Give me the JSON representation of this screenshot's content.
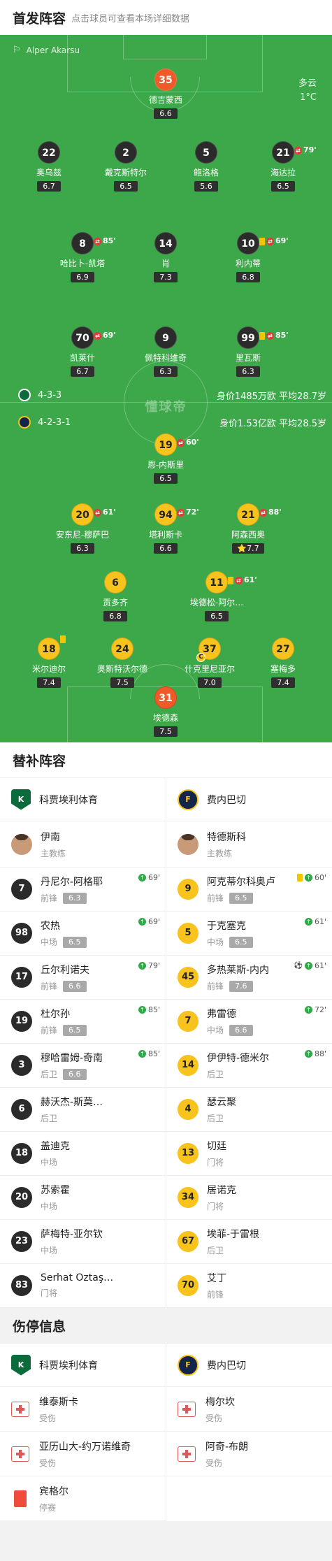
{
  "lineup": {
    "title": "首发阵容",
    "subtitle": "点击球员可查看本场详细数据",
    "referee": "Alper Akarsu",
    "weather": {
      "desc": "多云",
      "temp": "1°C"
    },
    "watermark": "懂球帝",
    "home": {
      "formation": "4-3-3",
      "worth": "身价1485万欧",
      "age": "平均28.7岁",
      "color": "#0c6b3c"
    },
    "away": {
      "formation": "4-2-3-1",
      "worth": "身价1.53亿欧",
      "age": "平均28.5岁",
      "color": "#13254b"
    },
    "players": [
      {
        "num": "35",
        "name": "德吉蒙西",
        "rating": "6.6",
        "side": "gk-home"
      },
      {
        "num": "22",
        "name": "奥乌兹",
        "rating": "6.7",
        "side": "home"
      },
      {
        "num": "2",
        "name": "戴克斯特尔",
        "rating": "6.5",
        "side": "home"
      },
      {
        "num": "5",
        "name": "鲍洛格",
        "rating": "5.6",
        "side": "home"
      },
      {
        "num": "21",
        "name": "海达拉",
        "rating": "6.5",
        "side": "home",
        "sub": "79'"
      },
      {
        "num": "8",
        "name": "哈比卜-凯塔",
        "rating": "6.9",
        "side": "home",
        "sub": "85'"
      },
      {
        "num": "14",
        "name": "肖",
        "rating": "7.3",
        "side": "home"
      },
      {
        "num": "10",
        "name": "利内蒂",
        "rating": "6.8",
        "side": "home",
        "sub": "69'",
        "card": "yellow"
      },
      {
        "num": "70",
        "name": "凯莱什",
        "rating": "6.7",
        "side": "home",
        "sub": "69'"
      },
      {
        "num": "9",
        "name": "佩特科维奇",
        "rating": "6.3",
        "side": "home"
      },
      {
        "num": "99",
        "name": "里瓦斯",
        "rating": "6.3",
        "side": "home",
        "sub": "85'",
        "card": "yellow"
      },
      {
        "num": "19",
        "name": "恩-内斯里",
        "rating": "6.5",
        "side": "away",
        "sub": "60'"
      },
      {
        "num": "20",
        "name": "安东尼-穆萨巴",
        "rating": "6.3",
        "side": "away",
        "sub": "61'"
      },
      {
        "num": "94",
        "name": "塔利斯卡",
        "rating": "6.6",
        "side": "away",
        "sub": "72'"
      },
      {
        "num": "21",
        "name": "阿森西奥",
        "rating": "7.7",
        "side": "away",
        "sub": "88'",
        "star": "⭐"
      },
      {
        "num": "6",
        "name": "贡多齐",
        "rating": "6.8",
        "side": "away"
      },
      {
        "num": "11",
        "name": "埃德松-阿尔…",
        "rating": "6.5",
        "side": "away",
        "sub": "61'",
        "card": "yellow"
      },
      {
        "num": "18",
        "name": "米尔迪尔",
        "rating": "7.4",
        "side": "away",
        "card": "yellow"
      },
      {
        "num": "24",
        "name": "奥斯特沃尔德",
        "rating": "7.5",
        "side": "away"
      },
      {
        "num": "37",
        "name": "什克里尼亚尔",
        "rating": "7.0",
        "side": "away",
        "captain": "C"
      },
      {
        "num": "27",
        "name": "塞梅多",
        "rating": "7.4",
        "side": "away"
      },
      {
        "num": "31",
        "name": "埃德森",
        "rating": "7.5",
        "side": "gk-away"
      }
    ]
  },
  "subs": {
    "title": "替补阵容",
    "home_team": "科贾埃利体育",
    "away_team": "费内巴切",
    "home_coach": {
      "name": "伊南",
      "role": "主教练"
    },
    "away_coach": {
      "name": "特德斯科",
      "role": "主教练"
    },
    "home": [
      {
        "num": "7",
        "name": "丹尼尔-阿格耶",
        "pos": "前锋",
        "rating": "6.3",
        "in": "69'"
      },
      {
        "num": "98",
        "name": "农热",
        "pos": "中场",
        "rating": "6.5",
        "in": "69'"
      },
      {
        "num": "17",
        "name": "丘尔利诺夫",
        "pos": "前锋",
        "rating": "6.6",
        "in": "79'"
      },
      {
        "num": "19",
        "name": "杜尔孙",
        "pos": "前锋",
        "rating": "6.5",
        "in": "85'"
      },
      {
        "num": "3",
        "name": "穆哈雷姆-奇南",
        "pos": "后卫",
        "rating": "6.6",
        "in": "85'"
      },
      {
        "num": "6",
        "name": "赫沃杰-斯莫…",
        "pos": "后卫"
      },
      {
        "num": "18",
        "name": "盖迪克",
        "pos": "中场"
      },
      {
        "num": "20",
        "name": "苏索霍",
        "pos": "中场"
      },
      {
        "num": "23",
        "name": "萨梅特-亚尔钦",
        "pos": "中场"
      },
      {
        "num": "83",
        "name": "Serhat Öztaş…",
        "pos": "门将"
      }
    ],
    "away": [
      {
        "num": "9",
        "name": "阿克蒂尔科奥卢",
        "pos": "前锋",
        "rating": "6.5",
        "in": "60'",
        "card": "yellow"
      },
      {
        "num": "5",
        "name": "于克塞克",
        "pos": "中场",
        "rating": "6.5",
        "in": "61'"
      },
      {
        "num": "45",
        "name": "多热莱斯-内内",
        "pos": "前锋",
        "rating": "7.6",
        "in": "61'",
        "goal": "⚽"
      },
      {
        "num": "7",
        "name": "弗雷德",
        "pos": "中场",
        "rating": "6.6",
        "in": "72'"
      },
      {
        "num": "14",
        "name": "伊伊特-德米尔",
        "pos": "后卫",
        "in": "88'"
      },
      {
        "num": "4",
        "name": "瑟云聚",
        "pos": "后卫"
      },
      {
        "num": "13",
        "name": "切廷",
        "pos": "门将"
      },
      {
        "num": "34",
        "name": "居诺克",
        "pos": "门将"
      },
      {
        "num": "67",
        "name": "埃菲-于雷根",
        "pos": "后卫"
      },
      {
        "num": "70",
        "name": "艾丁",
        "pos": "前锋"
      }
    ]
  },
  "injury": {
    "title": "伤停信息",
    "home_team": "科贾埃利体育",
    "away_team": "费内巴切",
    "home": [
      {
        "name": "维泰斯卡",
        "status": "受伤",
        "type": "injury"
      },
      {
        "name": "亚历山大-约万诺维奇",
        "status": "受伤",
        "type": "injury"
      },
      {
        "name": "宾格尔",
        "status": "停赛",
        "type": "suspension"
      }
    ],
    "away": [
      {
        "name": "梅尔坎",
        "status": "受伤",
        "type": "injury"
      },
      {
        "name": "阿奇-布朗",
        "status": "受伤",
        "type": "injury"
      }
    ]
  }
}
